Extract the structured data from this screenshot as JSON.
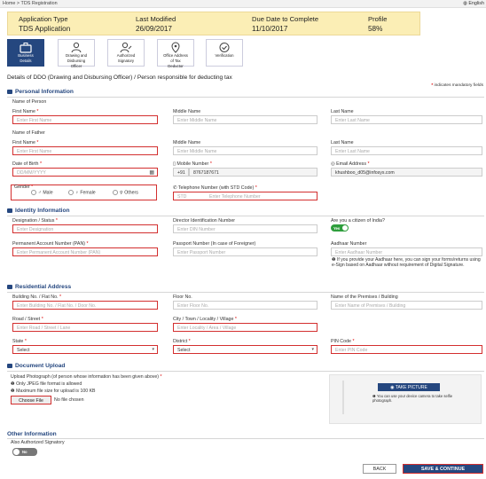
{
  "breadcrumb": {
    "home": "Home",
    "sep": ">",
    "current": "TDS Registration"
  },
  "language": "English",
  "summary": {
    "headers": [
      "Application Type",
      "Last Modified",
      "Due Date to Complete",
      "Profile"
    ],
    "values": [
      "TDS Application",
      "26/09/2017",
      "11/10/2017",
      "58%"
    ]
  },
  "steps": [
    {
      "label_1": "Business",
      "label_2": "Details",
      "icon": "briefcase-icon"
    },
    {
      "label_1": "Drawing and",
      "label_2": "Disbursing",
      "label_3": "Officer",
      "icon": "officer-icon"
    },
    {
      "label_1": "Authorized",
      "label_2": "Signatory",
      "icon": "signatory-icon"
    },
    {
      "label_1": "Office Address",
      "label_2": "of Tax",
      "label_3": "Deductor",
      "icon": "location-icon"
    },
    {
      "label_1": "Verification",
      "icon": "check-icon"
    }
  ],
  "page_title": "Details of DDO (Drawing and Disbursing Officer) / Person responsible for deducting tax",
  "mandatory_note": "indicates mandatory fields",
  "personal": {
    "section": "Personal Information",
    "name_of_person": "Name of Person",
    "first_name": {
      "label": "First Name",
      "placeholder": "Enter First Name"
    },
    "middle_name": {
      "label": "Middle Name",
      "placeholder": "Enter Middle Name"
    },
    "last_name": {
      "label": "Last Name",
      "placeholder": "Enter Last Name"
    },
    "name_of_father": "Name of Father",
    "f_first_name": {
      "label": "First Name",
      "placeholder": "Enter First Name"
    },
    "f_middle_name": {
      "label": "Middle Name",
      "placeholder": "Enter Middle Name"
    },
    "f_last_name": {
      "label": "Last Name",
      "placeholder": "Enter Last Name"
    },
    "dob": {
      "label": "Date of Birth",
      "placeholder": "DD/MM/YYYY"
    },
    "mobile": {
      "label": "Mobile Number",
      "code": "+91",
      "value": "8767187671"
    },
    "email": {
      "label": "Email Address",
      "value": "khushboo_d05@infosys.com"
    },
    "gender": {
      "label": "Gender",
      "options": [
        "Male",
        "Female",
        "Others"
      ]
    },
    "telephone": {
      "label": "Telephone Number (with STD Code)",
      "std": "STD",
      "placeholder": "Enter Telephone Number"
    }
  },
  "identity": {
    "section": "Identity Information",
    "designation": {
      "label": "Designation / Status",
      "placeholder": "Enter Designation"
    },
    "din": {
      "label": "Director Identification Number",
      "placeholder": "Enter DIN Number"
    },
    "citizen": {
      "label": "Are you a citizen of India?",
      "toggle": "Yes"
    },
    "pan": {
      "label": "Permanent Account Number (PAN)",
      "placeholder": "Enter Permanent Account Number (PAN)"
    },
    "passport": {
      "label": "Passport Number (In case of Foreigner)",
      "placeholder": "Enter Passport Number"
    },
    "aadhaar": {
      "label": "Aadhaar Number",
      "placeholder": "Enter Aadhaar Number"
    },
    "aadhaar_info": "If you provide your Aadhaar here, you can sign your forms/returns using e-Sign based on Aadhaar without requirement of Digital Signature."
  },
  "residential": {
    "section": "Residential Address",
    "building": {
      "label": "Building No. / Flat No.",
      "placeholder": "Enter Building No. / Flat No. / Door No."
    },
    "floor": {
      "label": "Floor No.",
      "placeholder": "Enter Floor No."
    },
    "premises": {
      "label": "Name of the Premises / Building",
      "placeholder": "Enter Name of Premises / Building"
    },
    "road": {
      "label": "Road / Street",
      "placeholder": "Enter Road / Street / Lane"
    },
    "city": {
      "label": "City / Town / Locality / Village",
      "placeholder": "Enter Locality / Area / Village"
    },
    "state": {
      "label": "State",
      "selected": "Select"
    },
    "district": {
      "label": "District",
      "selected": "Select"
    },
    "pin": {
      "label": "PIN Code",
      "placeholder": "Enter PIN Code"
    }
  },
  "document": {
    "section": "Document Upload",
    "upload_label": "Upload Photograph (of person whose information has been given above)",
    "rule_1": "Only JPEG file format is allowed",
    "rule_2": "Maximum file size for upload is 100 KB",
    "choose": "Choose File",
    "no_file": "No file chosen",
    "take_picture": "TAKE PICTURE",
    "camera_hint": "You can use your device camera to take selfie photograph."
  },
  "other": {
    "section": "Other Information",
    "also_signatory": "Also Authorized Signatory",
    "toggle": "No"
  },
  "buttons": {
    "back": "BACK",
    "save": "SAVE & CONTINUE"
  },
  "colors": {
    "primary": "#25477f",
    "summary_bg": "#fbeeb5",
    "error": "#d32f2f",
    "toggle_yes": "#2e9e3c",
    "toggle_no": "#777777"
  }
}
